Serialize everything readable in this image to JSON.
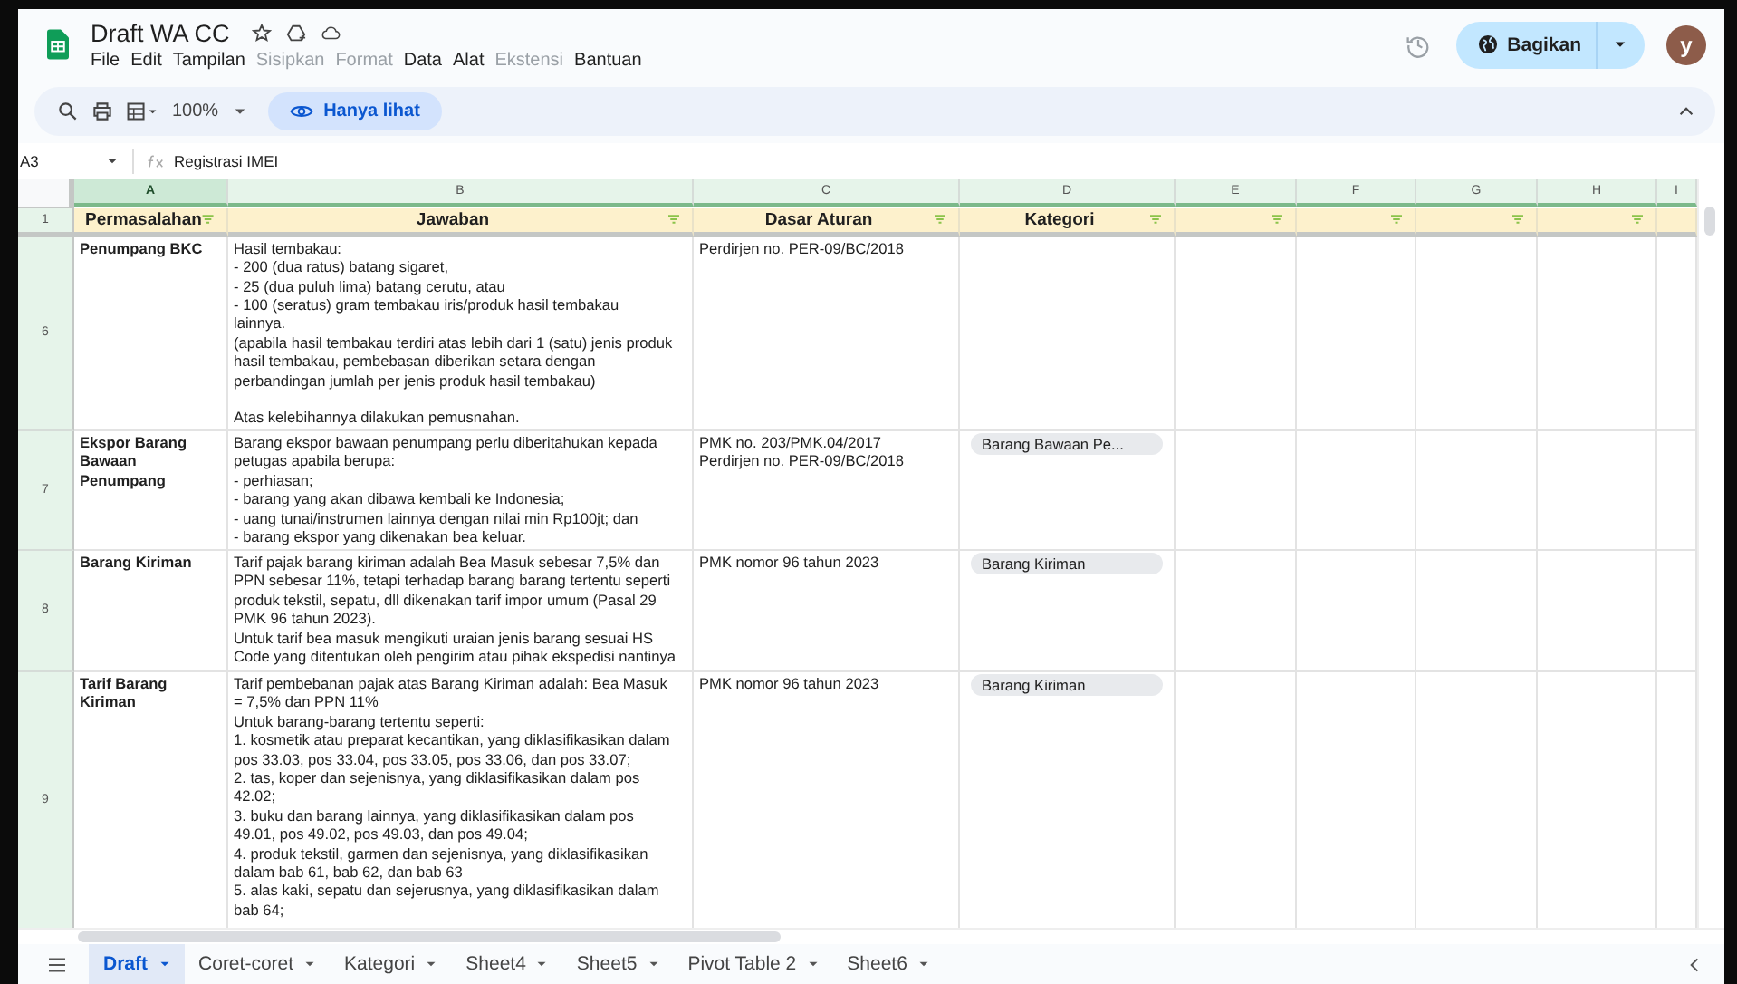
{
  "document": {
    "title": "Draft WA CC"
  },
  "menu": [
    {
      "label": "File",
      "disabled": false
    },
    {
      "label": "Edit",
      "disabled": false
    },
    {
      "label": "Tampilan",
      "disabled": false
    },
    {
      "label": "Sisipkan",
      "disabled": true
    },
    {
      "label": "Format",
      "disabled": true
    },
    {
      "label": "Data",
      "disabled": false
    },
    {
      "label": "Alat",
      "disabled": false
    },
    {
      "label": "Ekstensi",
      "disabled": true
    },
    {
      "label": "Bantuan",
      "disabled": false
    }
  ],
  "share": {
    "label": "Bagikan"
  },
  "avatar": {
    "initial": "y"
  },
  "toolbar": {
    "zoom": "100%",
    "mode": "Hanya lihat"
  },
  "formula_bar": {
    "cell": "A3",
    "value": "Registrasi IMEI"
  },
  "columns": [
    {
      "label": "A",
      "selected": true
    },
    {
      "label": "B",
      "selected": false
    },
    {
      "label": "C",
      "selected": false
    },
    {
      "label": "D",
      "selected": false
    },
    {
      "label": "E",
      "selected": false
    },
    {
      "label": "F",
      "selected": false
    },
    {
      "label": "G",
      "selected": false
    },
    {
      "label": "H",
      "selected": false
    },
    {
      "label": "I",
      "selected": false
    }
  ],
  "header_row": {
    "number": "1",
    "cells": [
      {
        "text": "Permasalahan",
        "filter": true
      },
      {
        "text": "Jawaban",
        "filter": true
      },
      {
        "text": "Dasar Aturan",
        "filter": true
      },
      {
        "text": "Kategori",
        "filter": true
      },
      {
        "filter": true
      },
      {
        "filter": true
      },
      {
        "filter": true
      },
      {
        "filter": true
      },
      {
        "filter": false
      }
    ]
  },
  "rows": [
    {
      "number": "6",
      "problem": "Penumpang BKC",
      "answer": "Hasil tembakau:\n- 200 (dua ratus) batang sigaret,\n- 25 (dua puluh lima) batang cerutu, atau\n- 100 (seratus) gram tembakau iris/produk hasil tembakau\nlainnya.\n(apabila hasil tembakau terdiri atas lebih dari 1 (satu) jenis produk\nhasil tembakau, pembebasan diberikan setara dengan\nperbandingan jumlah per jenis produk hasil tembakau)\n\nAtas kelebihannya dilakukan pemusnahan.",
      "basis": "Perdirjen no. PER-09/BC/2018"
    },
    {
      "number": "7",
      "problem": "Ekspor Barang\nBawaan\nPenumpang",
      "answer": "Barang ekspor bawaan penumpang perlu diberitahukan kepada\npetugas apabila berupa:\n- perhiasan;\n- barang yang akan dibawa kembali ke Indonesia;\n- uang tunai/instrumen lainnya dengan nilai min Rp100jt; dan\n- barang ekspor yang dikenakan bea keluar.",
      "basis": "PMK no. 203/PMK.04/2017\nPerdirjen no. PER-09/BC/2018",
      "category": "Barang Bawaan Pe..."
    },
    {
      "number": "8",
      "problem": "Barang Kiriman",
      "answer": "Tarif pajak barang kiriman adalah Bea Masuk sebesar 7,5% dan\nPPN sebesar 11%, tetapi terhadap barang barang tertentu seperti\nproduk tekstil, sepatu, dll dikenakan tarif impor umum (Pasal 29\nPMK 96 tahun 2023).\nUntuk tarif bea masuk mengikuti uraian jenis barang sesuai HS\nCode yang ditentukan oleh pengirim atau pihak ekspedisi nantinya",
      "basis": "PMK nomor 96 tahun 2023",
      "category": "Barang Kiriman"
    },
    {
      "number": "9",
      "problem": "Tarif Barang\nKiriman",
      "answer": "Tarif pembebanan pajak atas Barang Kiriman adalah: Bea Masuk\n= 7,5% dan PPN 11%\nUntuk barang-barang tertentu seperti:\n1. kosmetik atau preparat kecantikan, yang diklasifikasikan dalam\npos 33.03, pos 33.04, pos 33.05, pos 33.06, dan pos 33.07;\n2. tas, koper dan sejenisnya, yang diklasifikasikan dalam pos\n42.02;\n3. buku dan barang lainnya, yang diklasifikasikan dalam pos\n49.01, pos 49.02, pos 49.03, dan pos 49.04;\n4. produk tekstil, garmen dan sejenisnya, yang diklasifikasikan\ndalam bab 61, bab 62, dan bab 63\n5. alas kaki, sepatu dan sejerusnya, yang diklasifikasikan dalam\nbab 64;",
      "basis": "PMK nomor 96 tahun 2023",
      "category": "Barang Kiriman"
    }
  ],
  "sheet_tabs": [
    {
      "label": "Draft",
      "selected": true
    },
    {
      "label": "Coret-coret",
      "selected": false
    },
    {
      "label": "Kategori",
      "selected": false
    },
    {
      "label": "Sheet4",
      "selected": false
    },
    {
      "label": "Sheet5",
      "selected": false
    },
    {
      "label": "Pivot Table 2",
      "selected": false
    },
    {
      "label": "Sheet6",
      "selected": false
    }
  ]
}
